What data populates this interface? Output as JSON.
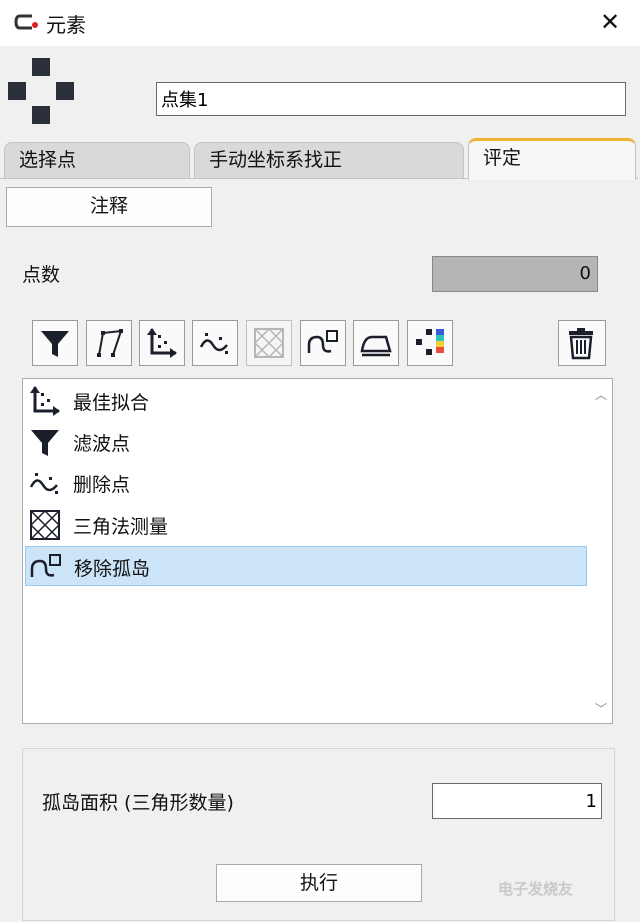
{
  "window": {
    "title": "元素",
    "close_glyph": "✕"
  },
  "header": {
    "name_value": "点集1"
  },
  "tabs": [
    {
      "label": "选择点",
      "active": false
    },
    {
      "label": "手动坐标系找正",
      "active": false
    },
    {
      "label": "评定",
      "active": true
    }
  ],
  "annotation_button": "注释",
  "point_count": {
    "label": "点数",
    "value": "0"
  },
  "toolbar": [
    {
      "icon": "funnel-icon"
    },
    {
      "icon": "polyline-icon"
    },
    {
      "icon": "best-fit-icon"
    },
    {
      "icon": "delete-points-icon"
    },
    {
      "icon": "triangulation-icon",
      "disabled": true
    },
    {
      "icon": "remove-islands-icon"
    },
    {
      "icon": "iron-icon"
    },
    {
      "icon": "color-map-icon"
    },
    {
      "icon": "trash-icon"
    }
  ],
  "operations": [
    {
      "label": "最佳拟合",
      "icon": "best-fit-icon"
    },
    {
      "label": "滤波点",
      "icon": "funnel-icon"
    },
    {
      "label": "删除点",
      "icon": "delete-points-icon"
    },
    {
      "label": "三角法测量",
      "icon": "triangulation-icon"
    },
    {
      "label": "移除孤岛",
      "icon": "remove-islands-icon",
      "selected": true
    }
  ],
  "island": {
    "label": "孤岛面积 (三角形数量)",
    "value": "1"
  },
  "execute_button": "执行",
  "watermark": "电子发烧友",
  "colors": {
    "selection": "#cce4f7",
    "tab_accent": "#f0b030",
    "disabled_field": "#b5b5b5"
  }
}
